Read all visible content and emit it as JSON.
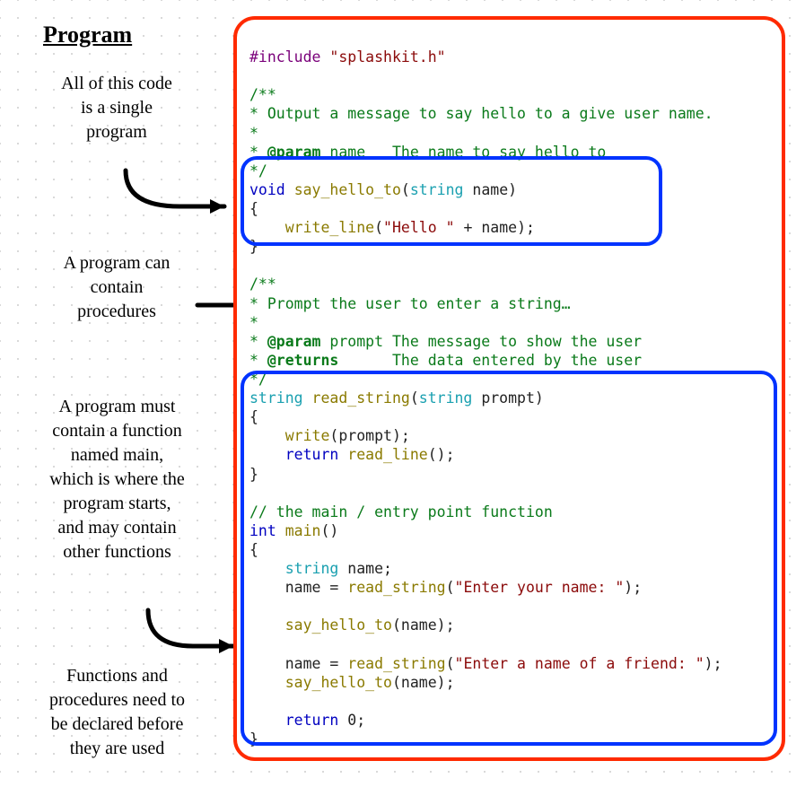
{
  "title": "Program",
  "annotations": {
    "a1": "All of this code\nis a single\nprogram",
    "a2": "A program can\ncontain\nprocedures",
    "a3": "A program must\ncontain a function\nnamed main,\nwhich is where the\nprogram starts,\nand may contain\nother functions",
    "a4": "Functions and\nprocedures need to\nbe declared before\nthey are used"
  },
  "code": {
    "l1": {
      "pp": "#include",
      "sp": " ",
      "str": "\"splashkit.h\""
    },
    "l2": "",
    "l3": {
      "cm": "/**"
    },
    "l4": {
      "cm": "* Output a message to say hello to a give user name."
    },
    "l5": {
      "cm": "*"
    },
    "l6a": {
      "cm": "* "
    },
    "l6b": {
      "cm": "@param"
    },
    "l6c": {
      "cm": " name   The name to say hello to"
    },
    "l7": {
      "cm": "*/"
    },
    "l8": {
      "kw": "void",
      "sp": " ",
      "fn": "say_hello_to",
      "p1": "(",
      "type": "string",
      "sp2": " ",
      "v": "name",
      "p2": ")"
    },
    "l9": "{",
    "l10": {
      "ind": "    ",
      "fn": "write_line",
      "p1": "(",
      "str": "\"Hello \"",
      "op": " + ",
      "v": "name",
      "p2": ");"
    },
    "l11": "}",
    "l12": "",
    "l13": {
      "cm": "/**"
    },
    "l14": {
      "cm": "* Prompt the user to enter a string…"
    },
    "l15": {
      "cm": "*"
    },
    "l16a": {
      "cm": "* "
    },
    "l16b": {
      "cm": "@param"
    },
    "l16c": {
      "cm": " prompt The message to show the user"
    },
    "l17a": {
      "cm": "* "
    },
    "l17b": {
      "cm": "@returns"
    },
    "l17c": {
      "cm": "      The data entered by the user"
    },
    "l18": {
      "cm": "*/"
    },
    "l19": {
      "type": "string",
      "sp": " ",
      "fn": "read_string",
      "p1": "(",
      "type2": "string",
      "sp2": " ",
      "v": "prompt",
      "p2": ")"
    },
    "l20": "{",
    "l21": {
      "ind": "    ",
      "fn": "write",
      "p1": "(",
      "v": "prompt",
      "p2": ");"
    },
    "l22": {
      "ind": "    ",
      "kw": "return",
      "sp": " ",
      "fn": "read_line",
      "p": "();"
    },
    "l23": "}",
    "l24": "",
    "l25": {
      "cm": "// the main / entry point function"
    },
    "l26": {
      "kw": "int",
      "sp": " ",
      "fn": "main",
      "p": "()"
    },
    "l27": "{",
    "l28": {
      "ind": "    ",
      "type": "string",
      "sp": " ",
      "v": "name;"
    },
    "l29": {
      "ind": "    ",
      "v": "name = ",
      "fn": "read_string",
      "p1": "(",
      "str": "\"Enter your name: \"",
      "p2": ");"
    },
    "l30": "",
    "l31": {
      "ind": "    ",
      "fn": "say_hello_to",
      "p1": "(",
      "v": "name",
      "p2": ");"
    },
    "l32": "",
    "l33": {
      "ind": "    ",
      "v": "name = ",
      "fn": "read_string",
      "p1": "(",
      "str": "\"Enter a name of a friend: \"",
      "p2": ");"
    },
    "l34": {
      "ind": "    ",
      "fn": "say_hello_to",
      "p1": "(",
      "v": "name",
      "p2": ");"
    },
    "l35": "",
    "l36": {
      "ind": "    ",
      "kw": "return",
      "sp": " ",
      "v": "0;"
    },
    "l37": "}"
  }
}
